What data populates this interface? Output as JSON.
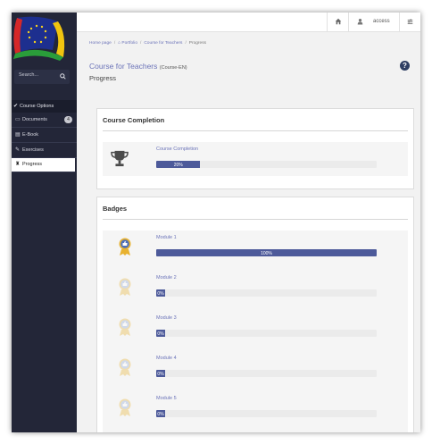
{
  "sidebar": {
    "search_placeholder": "Search...",
    "course_options_label": "Course Options",
    "items": [
      {
        "label": "Documents",
        "badge": "4",
        "icon": "folder-icon"
      },
      {
        "label": "E-Book",
        "icon": "book-icon"
      },
      {
        "label": "Exercises",
        "icon": "edit-icon"
      },
      {
        "label": "Progress",
        "icon": "trophy-icon"
      }
    ]
  },
  "topbar": {
    "user_label": "access"
  },
  "breadcrumb": {
    "home": "Home page",
    "portfolio": "Portfolio",
    "course": "Course for Teachers",
    "current": "Progress"
  },
  "page": {
    "title": "Course for Teachers",
    "code": "(Course-EN)",
    "subtitle": "Progress"
  },
  "completion": {
    "heading": "Course Completion",
    "label": "Course Completion",
    "percent_text": "20%",
    "progress": 0.2
  },
  "badges": {
    "heading": "Badges",
    "items": [
      {
        "label": "Module 1",
        "percent_text": "100%",
        "progress": 1.0,
        "earned": true
      },
      {
        "label": "Module 2",
        "percent_text": "0%",
        "progress": 0.0,
        "earned": false
      },
      {
        "label": "Module 3",
        "percent_text": "0%",
        "progress": 0.0,
        "earned": false
      },
      {
        "label": "Module 4",
        "percent_text": "0%",
        "progress": 0.0,
        "earned": false
      },
      {
        "label": "Module 5",
        "percent_text": "0%",
        "progress": 0.0,
        "earned": false
      }
    ]
  },
  "colors": {
    "sidebar": "#232638",
    "accent": "#6b73b8",
    "bar": "#4d5a9a",
    "medal_gold": "#e8b230"
  }
}
